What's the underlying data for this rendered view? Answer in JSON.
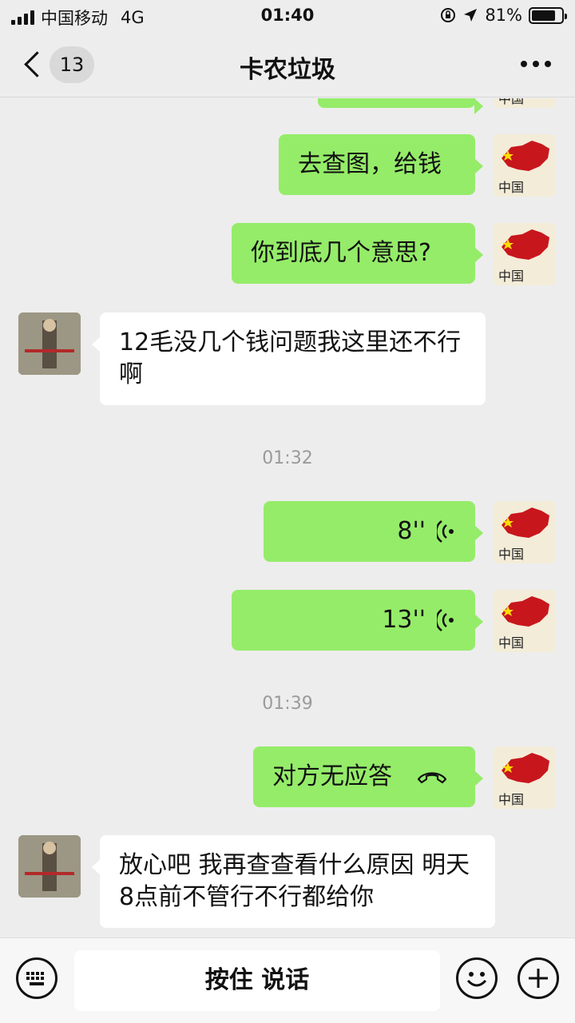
{
  "status_bar": {
    "carrier": "中国移动",
    "network": "4G",
    "time": "01:40",
    "battery_text": "81%",
    "battery_level": 0.81
  },
  "header": {
    "unread_count": "13",
    "title": "卡农垃圾"
  },
  "messages": [
    {
      "side": "me",
      "text": "去查图，给钱"
    },
    {
      "side": "me",
      "text": "你到底几个意思?"
    },
    {
      "side": "them",
      "text": "12毛没几个钱问题我这里还不行啊"
    },
    {
      "type": "time",
      "text": "01:32"
    },
    {
      "side": "me",
      "type": "voice",
      "duration": "8''"
    },
    {
      "side": "me",
      "type": "voice",
      "duration": "13''"
    },
    {
      "type": "time",
      "text": "01:39"
    },
    {
      "side": "me",
      "type": "call",
      "text": "对方无应答"
    },
    {
      "side": "them",
      "text": "放心吧 我再查查看什么原因 明天8点前不管行不行都给你"
    }
  ],
  "avatar_caption": "中国",
  "input_bar": {
    "hold_to_talk": "按住 说话"
  },
  "colors": {
    "my_bubble": "#95ec69",
    "their_bubble": "#ffffff",
    "background": "#ededed",
    "flag_red": "#c8161d"
  },
  "icons": [
    "back-icon",
    "more-icon",
    "voice-wave-icon",
    "hangup-phone-icon",
    "keyboard-icon",
    "emoji-icon",
    "plus-icon"
  ]
}
